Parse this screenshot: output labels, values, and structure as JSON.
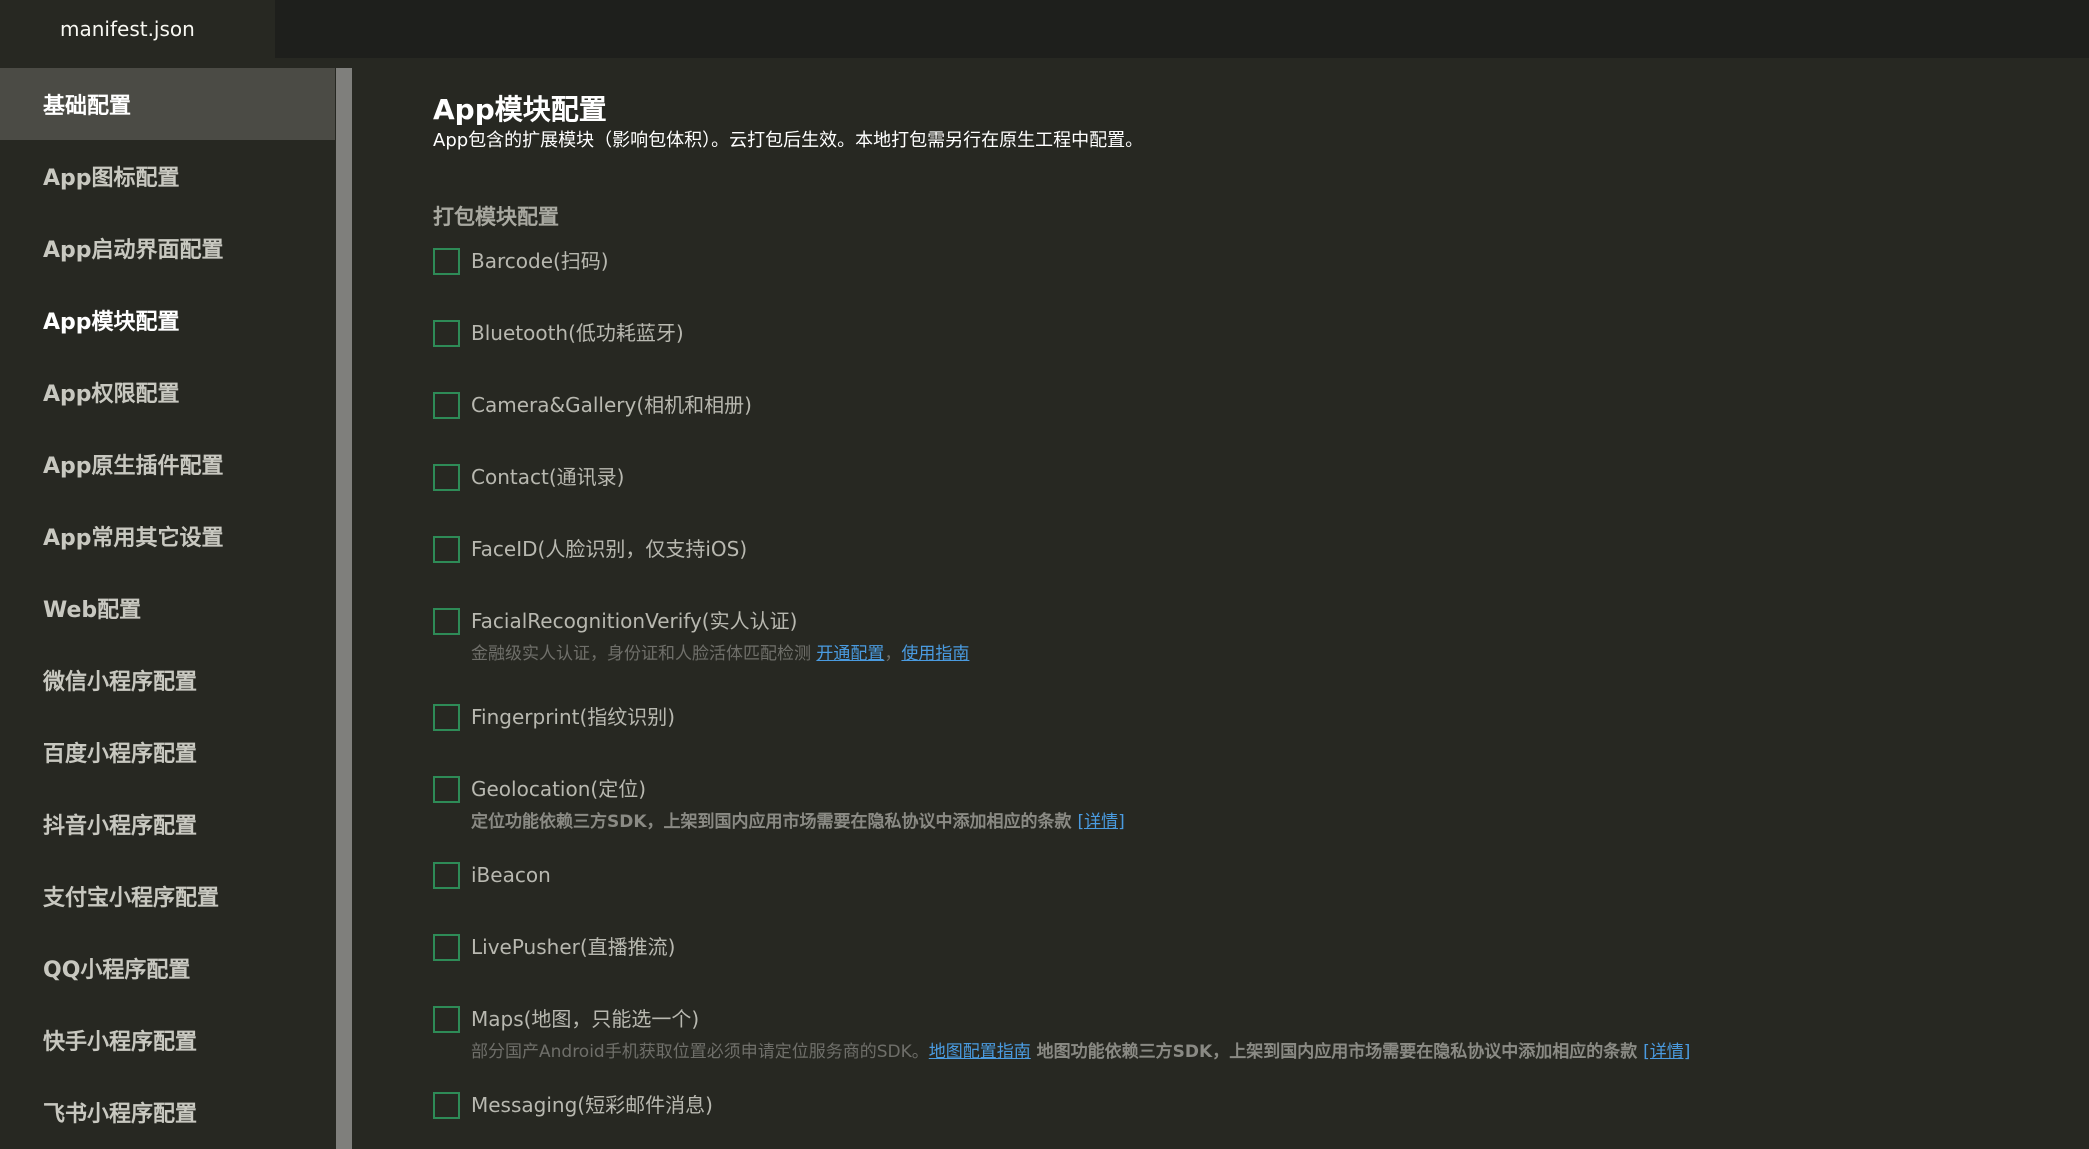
{
  "tab": {
    "title": "manifest.json"
  },
  "sidebar": {
    "items": [
      {
        "label": "基础配置"
      },
      {
        "label": "App图标配置"
      },
      {
        "label": "App启动界面配置"
      },
      {
        "label": "App模块配置"
      },
      {
        "label": "App权限配置"
      },
      {
        "label": "App原生插件配置"
      },
      {
        "label": "App常用其它设置"
      },
      {
        "label": "Web配置"
      },
      {
        "label": "微信小程序配置"
      },
      {
        "label": "百度小程序配置"
      },
      {
        "label": "抖音小程序配置"
      },
      {
        "label": "支付宝小程序配置"
      },
      {
        "label": "QQ小程序配置"
      },
      {
        "label": "快手小程序配置"
      },
      {
        "label": "飞书小程序配置"
      }
    ]
  },
  "main": {
    "title": "App模块配置",
    "description": "App包含的扩展模块（影响包体积）。云打包后生效。本地打包需另行在原生工程中配置。",
    "section_title": "打包模块配置",
    "modules": [
      {
        "label": "Barcode(扫码)",
        "checked": false
      },
      {
        "label": "Bluetooth(低功耗蓝牙)",
        "checked": false
      },
      {
        "label": "Camera&Gallery(相机和相册)",
        "checked": false
      },
      {
        "label": "Contact(通讯录)",
        "checked": false
      },
      {
        "label": "FaceID(人脸识别，仅支持iOS)",
        "checked": false
      },
      {
        "label": "FacialRecognitionVerify(实人认证)",
        "checked": false,
        "sub_text": "金融级实人认证，身份证和人脸活体匹配检测 ",
        "link1": "开通配置",
        "sep": "，",
        "link2": "使用指南"
      },
      {
        "label": "Fingerprint(指纹识别)",
        "checked": false
      },
      {
        "label": "Geolocation(定位)",
        "checked": false,
        "sub_bold": "定位功能依赖三方SDK，上架到国内应用市场需要在隐私协议中添加相应的条款 ",
        "link": "[详情]"
      },
      {
        "label": "iBeacon",
        "checked": false
      },
      {
        "label": "LivePusher(直播推流)",
        "checked": false
      },
      {
        "label": "Maps(地图，只能选一个)",
        "checked": false,
        "sub_text": "部分国产Android手机获取位置必须申请定位服务商的SDK。",
        "link1": "地图配置指南",
        "sub_bold": " 地图功能依赖三方SDK，上架到国内应用市场需要在隐私协议中添加相应的条款 ",
        "link2": "[详情]"
      },
      {
        "label": "Messaging(短彩邮件消息)",
        "checked": false
      }
    ]
  }
}
